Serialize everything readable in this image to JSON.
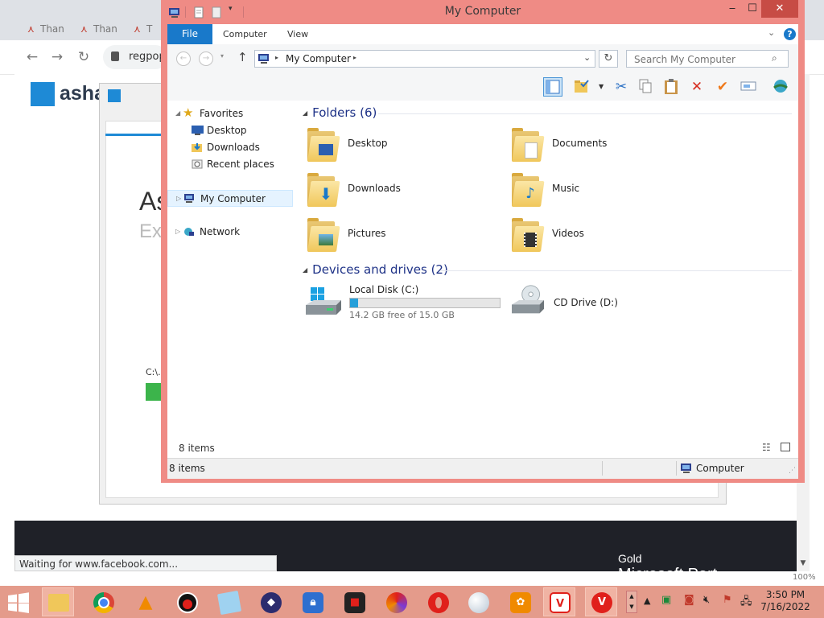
{
  "browser": {
    "tabs": [
      "Than",
      "Than",
      "T"
    ],
    "url": "regpop",
    "logo_text": "asha",
    "bg_title_1": "As",
    "bg_title_2": "Ex",
    "bg_path": "C:\\.",
    "status_text": "Waiting for www.facebook.com...",
    "promo_line_1": "Gold",
    "promo_line_2": "Microsoft Part",
    "zoom": "100%"
  },
  "explorer": {
    "title": "My Computer",
    "ribbon": {
      "file": "File",
      "tabs": [
        "Computer",
        "View"
      ]
    },
    "address": {
      "location": "My Computer"
    },
    "search": {
      "placeholder": "Search My Computer"
    },
    "nav": {
      "favorites": "Favorites",
      "fav_items": [
        "Desktop",
        "Downloads",
        "Recent places"
      ],
      "my_computer": "My Computer",
      "network": "Network"
    },
    "folders_header": "Folders (6)",
    "folders": [
      "Desktop",
      "Documents",
      "Downloads",
      "Music",
      "Pictures",
      "Videos"
    ],
    "drives_header": "Devices and drives (2)",
    "drives": [
      {
        "name": "Local Disk (C:)",
        "free": "14.2 GB free of 15.0 GB",
        "used_fraction": 0.053
      },
      {
        "name": "CD Drive (D:)"
      }
    ],
    "item_count": "8 items",
    "status_count": "8 items",
    "status_location": "Computer"
  },
  "taskbar": {
    "time": "3:50 PM",
    "date": "7/16/2022"
  },
  "colors": {
    "window_border": "#ef8b85",
    "accent": "#1979ca",
    "taskbar": "#e49b8b"
  }
}
